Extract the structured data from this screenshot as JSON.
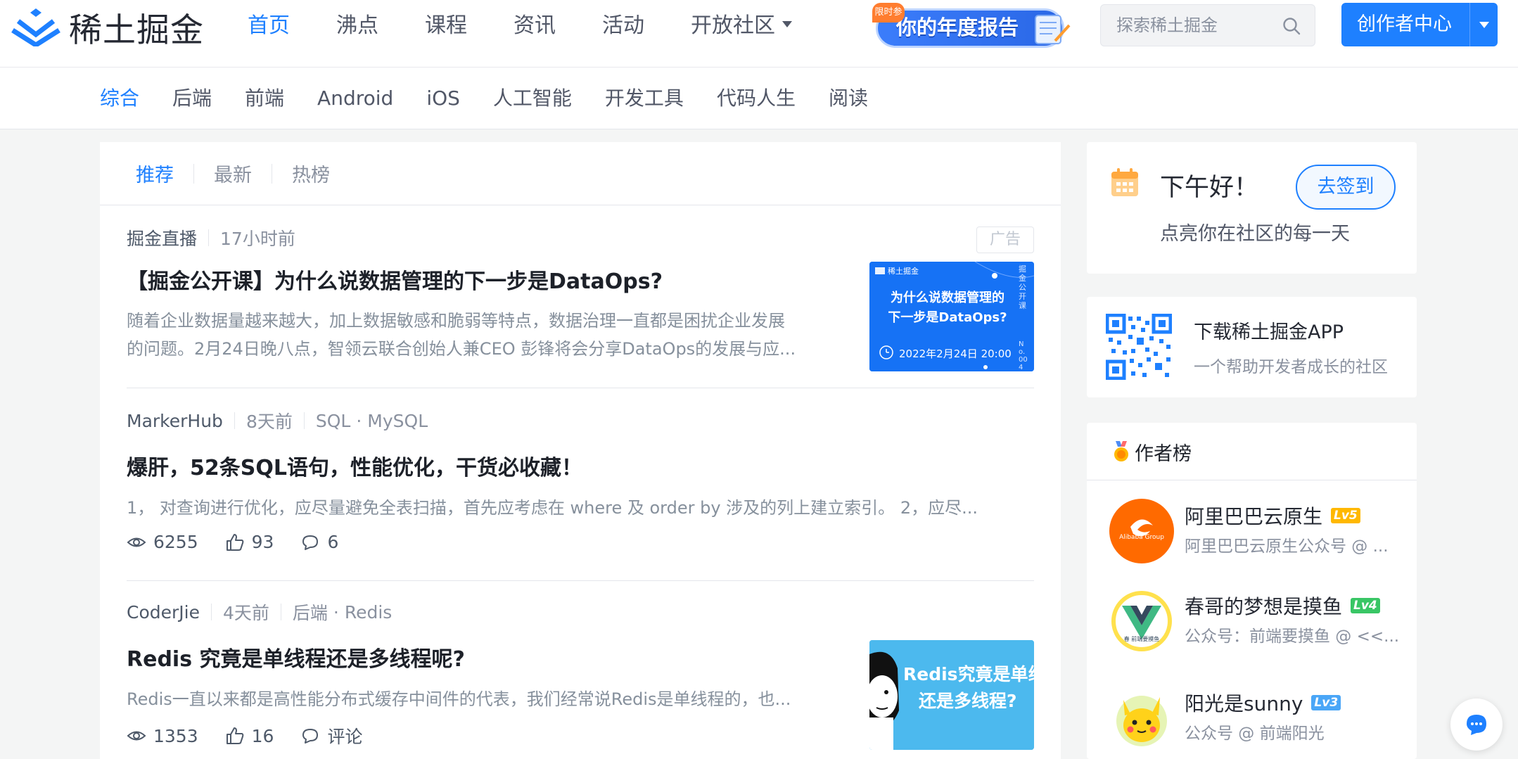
{
  "brand": {
    "name": "稀土掘金",
    "color": "#1e80ff"
  },
  "main_nav": [
    {
      "label": "首页",
      "active": true
    },
    {
      "label": "沸点"
    },
    {
      "label": "课程"
    },
    {
      "label": "资讯"
    },
    {
      "label": "活动"
    },
    {
      "label": "开放社区",
      "dropdown": true
    }
  ],
  "annual_banner": {
    "tag": "限时参",
    "text": "你的年度报告"
  },
  "search": {
    "placeholder": "探索稀土掘金"
  },
  "creator_button": {
    "label": "创作者中心"
  },
  "categories": [
    {
      "label": "综合",
      "active": true
    },
    {
      "label": "后端"
    },
    {
      "label": "前端"
    },
    {
      "label": "Android"
    },
    {
      "label": "iOS"
    },
    {
      "label": "人工智能"
    },
    {
      "label": "开发工具"
    },
    {
      "label": "代码人生"
    },
    {
      "label": "阅读"
    }
  ],
  "feed_tabs": [
    {
      "label": "推荐",
      "active": true
    },
    {
      "label": "最新"
    },
    {
      "label": "热榜"
    }
  ],
  "entries": [
    {
      "author": "掘金直播",
      "time": "17小时前",
      "ad_label": "广告",
      "title": "【掘金公开课】为什么说数据管理的下一步是DataOps?",
      "desc_lines": [
        "随着企业数据量越来越大，加上数据敏感和脆弱等特点，数据治理一直都是困扰企业发展",
        "的问题。2月24日晚八点，智领云联合创始人兼CEO 彭锋将会分享DataOps的发展与应..."
      ],
      "thumb": {
        "brand": "稀土掘金",
        "line1": "为什么说数据管理的",
        "line2": "下一步是DataOps?",
        "date": "2022年2月24日  20:00",
        "side_text": "掘金公开课",
        "issue": "No.004"
      }
    },
    {
      "author": "MarkerHub",
      "time": "8天前",
      "tags": [
        "SQL",
        "MySQL"
      ],
      "title": "爆肝，52条SQL语句，性能优化，干货必收藏！",
      "desc": "1， 对查询进行优化，应尽量避免全表扫描，首先应考虑在 where 及 order by 涉及的列上建立索引。   2，应尽...",
      "views": "6255",
      "likes": "93",
      "comments": "6"
    },
    {
      "author": "CoderJie",
      "time": "4天前",
      "tags": [
        "后端",
        "Redis"
      ],
      "title": "Redis 究竟是单线程还是多线程呢?",
      "desc": "Redis一直以来都是高性能分布式缓存中间件的代表，我们经常说Redis是单线程的，也...",
      "views": "1353",
      "likes": "16",
      "comments": "评论",
      "thumb": {
        "line1": "Redis究竟是单线",
        "line2": "还是多线程?"
      }
    }
  ],
  "tag_separator": "·",
  "sidebar": {
    "greeting": "下午好！",
    "greeting_sub": "点亮你在社区的每一天",
    "signin_label": "去签到",
    "app_title": "下载稀土掘金APP",
    "app_sub": "一个帮助开发者成长的社区",
    "author_board_title": "作者榜",
    "authors": [
      {
        "name": "阿里巴巴云原生",
        "level": "Lv5",
        "level_color": "#ffb800",
        "desc": "阿里巴巴云原生公众号 @ ...",
        "avatar_text": "Alibaba Group"
      },
      {
        "name": "春哥的梦想是摸鱼",
        "level": "Lv4",
        "level_color": "#39c665",
        "desc": "公众号：前端要摸鱼 @ <<...",
        "avatar_text": "春 前端要摸鱼"
      },
      {
        "name": "阳光是sunny",
        "level": "Lv3",
        "level_color": "#4aa6f7",
        "desc": "公众号 @ 前端阳光"
      }
    ]
  }
}
